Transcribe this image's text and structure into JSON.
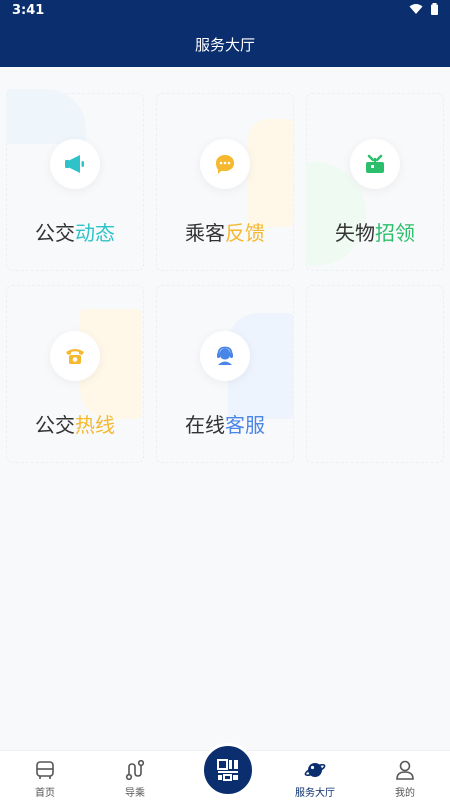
{
  "status_bar": {
    "time": "3:41"
  },
  "header": {
    "title": "服务大厅"
  },
  "services": [
    {
      "label_plain": "公交",
      "label_accent": "动态",
      "accent_color": "#2fc2c8",
      "icon": "megaphone-icon"
    },
    {
      "label_plain": "乘客",
      "label_accent": "反馈",
      "accent_color": "#f5b82e",
      "icon": "chat-bubble-icon"
    },
    {
      "label_plain": "失物",
      "label_accent": "招领",
      "accent_color": "#2bbf6b",
      "icon": "box-icon"
    },
    {
      "label_plain": "公交",
      "label_accent": "热线",
      "accent_color": "#f5b82e",
      "icon": "telephone-icon"
    },
    {
      "label_plain": "在线",
      "label_accent": "客服",
      "accent_color": "#4a86e8",
      "icon": "customer-service-icon"
    }
  ],
  "bottom_nav": {
    "items": [
      {
        "label": "首页",
        "icon": "bus-icon"
      },
      {
        "label": "导乘",
        "icon": "route-icon"
      },
      {
        "label": "",
        "icon": "qr-scan-icon"
      },
      {
        "label": "服务大厅",
        "icon": "planet-icon"
      },
      {
        "label": "我的",
        "icon": "user-icon"
      }
    ],
    "active": "服务大厅"
  }
}
